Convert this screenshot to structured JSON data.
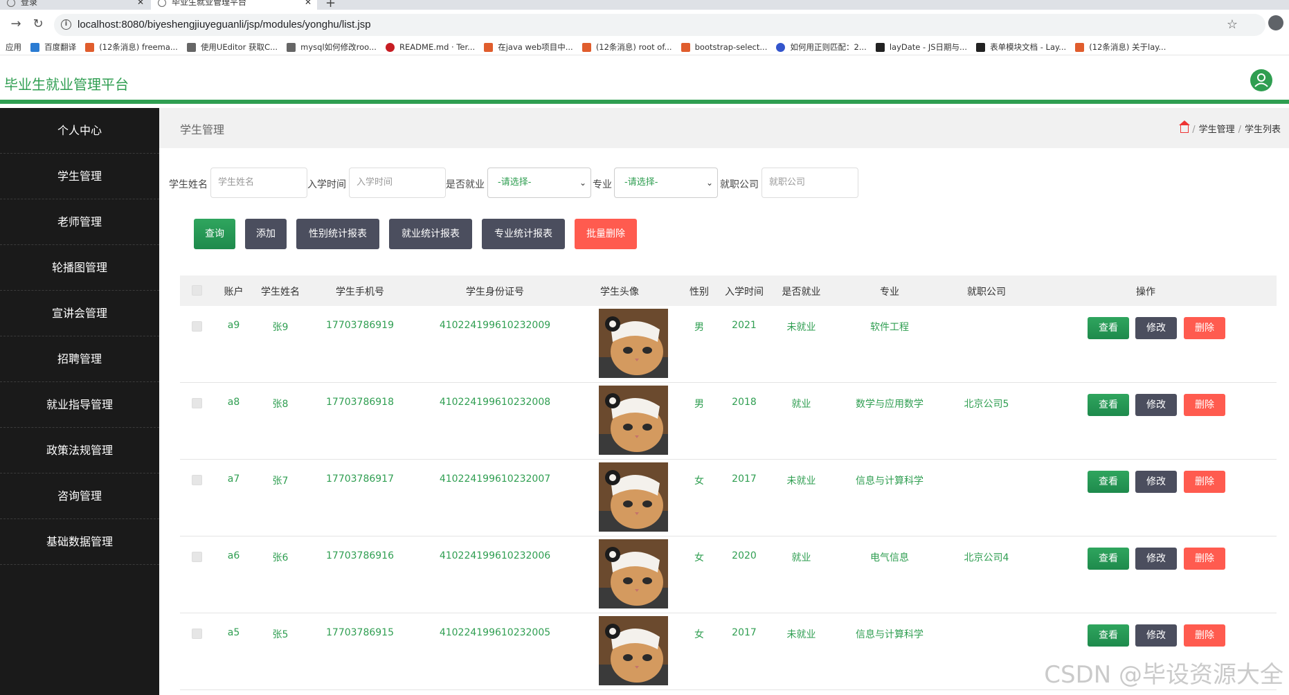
{
  "browser": {
    "tabs": [
      {
        "label": "登录"
      },
      {
        "label": "毕业生就业管理平台"
      }
    ],
    "url": "localhost:8080/biyeshengjiuyeguanli/jsp/modules/yonghu/list.jsp",
    "bookmarks": [
      {
        "label": "应用",
        "color": "#4285f4"
      },
      {
        "label": "百度翻译",
        "color": "#2b7cd3"
      },
      {
        "label": "(12条消息) freema...",
        "color": "#e05d2d"
      },
      {
        "label": "使用UEditor 获取C...",
        "color": "#333333"
      },
      {
        "label": "mysql如何修改roo...",
        "color": "#333333"
      },
      {
        "label": "README.md · Ter...",
        "color": "#c71d23"
      },
      {
        "label": "在java web项目中...",
        "color": "#e05d2d"
      },
      {
        "label": "(12条消息) root of...",
        "color": "#e05d2d"
      },
      {
        "label": "bootstrap-select...",
        "color": "#e05d2d"
      },
      {
        "label": "如何用正则匹配：2...",
        "color": "#3355cc"
      },
      {
        "label": "layDate - JS日期与...",
        "color": "#222222"
      },
      {
        "label": "表单模块文档 - Lay...",
        "color": "#222222"
      },
      {
        "label": "(12条消息) 关于lay...",
        "color": "#e05d2d"
      }
    ]
  },
  "app": {
    "title": "毕业生就业管理平台",
    "accent": "#2f9e51"
  },
  "sidebar": {
    "items": [
      {
        "label": "个人中心"
      },
      {
        "label": "学生管理"
      },
      {
        "label": "老师管理"
      },
      {
        "label": "轮播图管理"
      },
      {
        "label": "宣讲会管理"
      },
      {
        "label": "招聘管理"
      },
      {
        "label": "就业指导管理"
      },
      {
        "label": "政策法规管理"
      },
      {
        "label": "咨询管理"
      },
      {
        "label": "基础数据管理"
      }
    ]
  },
  "page": {
    "title": "学生管理",
    "breadcrumb": [
      "学生管理",
      "学生列表"
    ]
  },
  "search": {
    "name_label": "学生姓名",
    "name_placeholder": "学生姓名",
    "date_label": "入学时间",
    "date_placeholder": "入学时间",
    "employed_label": "是否就业",
    "employed_value": "-请选择-",
    "major_label": "专业",
    "major_value": "-请选择-",
    "company_label": "就职公司",
    "company_placeholder": "就职公司"
  },
  "buttons": {
    "query": "查询",
    "add": "添加",
    "gender_report": "性别统计报表",
    "employment_report": "就业统计报表",
    "major_report": "专业统计报表",
    "batch_delete": "批量删除"
  },
  "table": {
    "headers": [
      "账户",
      "学生姓名",
      "学生手机号",
      "学生身份证号",
      "学生头像",
      "性别",
      "入学时间",
      "是否就业",
      "专业",
      "就职公司",
      "操作"
    ],
    "actions": {
      "view": "查看",
      "edit": "修改",
      "delete": "删除"
    },
    "rows": [
      {
        "account": "a9",
        "name": "张9",
        "phone": "17703786919",
        "idcard": "410224199610232009",
        "gender": "男",
        "year": "2021",
        "employed": "未就业",
        "major": "软件工程",
        "company": ""
      },
      {
        "account": "a8",
        "name": "张8",
        "phone": "17703786918",
        "idcard": "410224199610232008",
        "gender": "男",
        "year": "2018",
        "employed": "就业",
        "major": "数学与应用数学",
        "company": "北京公司5"
      },
      {
        "account": "a7",
        "name": "张7",
        "phone": "17703786917",
        "idcard": "410224199610232007",
        "gender": "女",
        "year": "2017",
        "employed": "未就业",
        "major": "信息与计算科学",
        "company": ""
      },
      {
        "account": "a6",
        "name": "张6",
        "phone": "17703786916",
        "idcard": "410224199610232006",
        "gender": "女",
        "year": "2020",
        "employed": "就业",
        "major": "电气信息",
        "company": "北京公司4"
      },
      {
        "account": "a5",
        "name": "张5",
        "phone": "17703786915",
        "idcard": "410224199610232005",
        "gender": "女",
        "year": "2017",
        "employed": "未就业",
        "major": "信息与计算科学",
        "company": ""
      }
    ]
  },
  "watermark": "CSDN @毕设资源大全"
}
